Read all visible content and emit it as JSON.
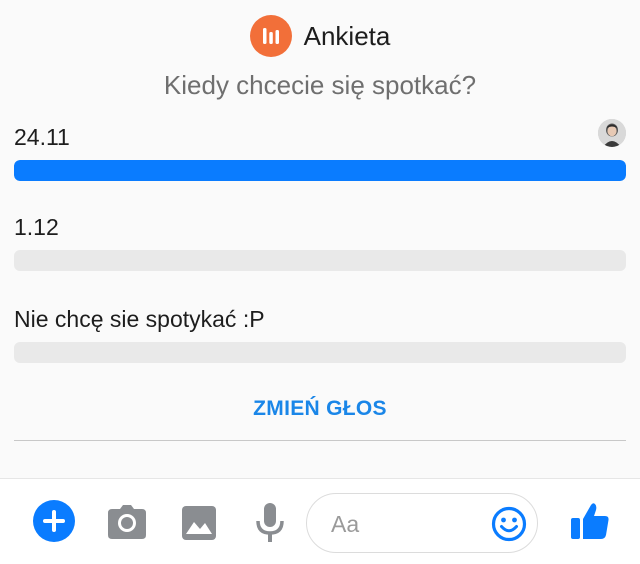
{
  "poll": {
    "title": "Ankieta",
    "question": "Kiedy chcecie się spotkać?",
    "options": [
      {
        "label": "24.11",
        "fill": 1.0,
        "voters": 1
      },
      {
        "label": "1.12",
        "fill": 0.0,
        "voters": 0
      },
      {
        "label": "Nie chcę sie spotykać :P",
        "fill": 0.0,
        "voters": 0
      }
    ],
    "change_vote_label": "ZMIEŃ GŁOS"
  },
  "composer": {
    "placeholder": "Aa",
    "tools": [
      "plus-icon",
      "camera-icon",
      "image-icon",
      "microphone-icon",
      "emoji-icon",
      "thumbs-up-icon"
    ]
  },
  "colors": {
    "accent": "#0a7cff",
    "poll_badge": "#f26f39",
    "bar_track": "#e9e9e9",
    "link": "#1a86e8"
  }
}
